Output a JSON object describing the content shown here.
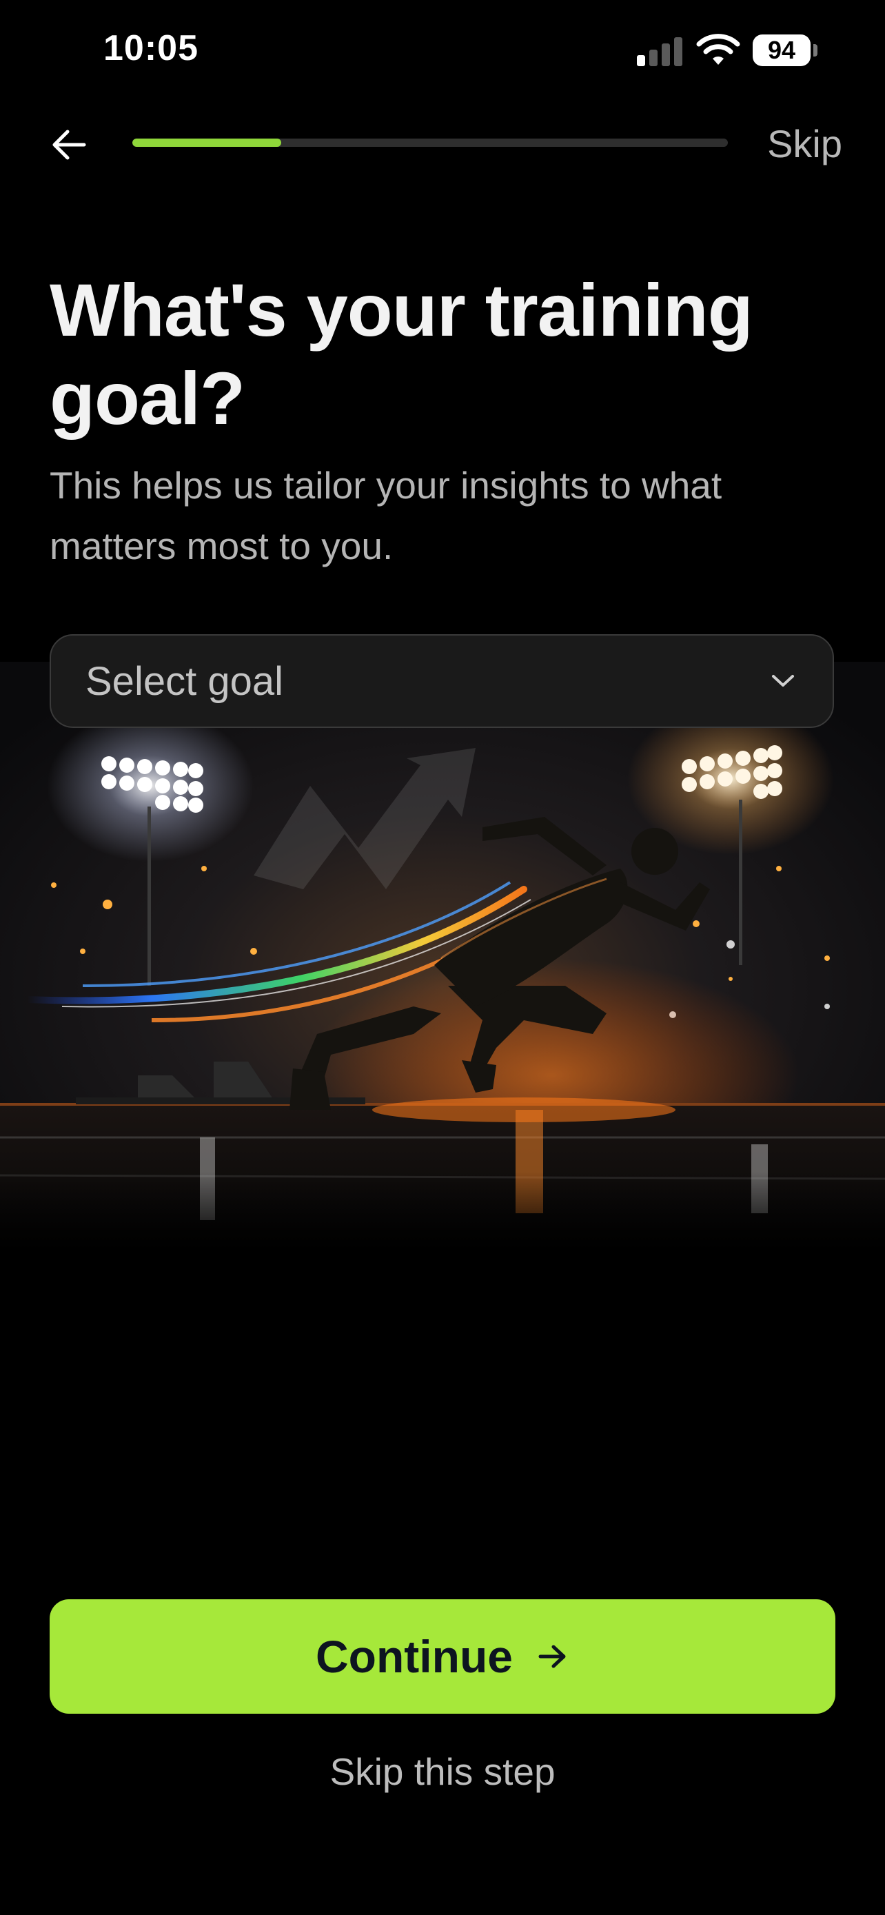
{
  "status_bar": {
    "time": "10:05",
    "battery_level": "94",
    "signal_bars_on": 1,
    "signal_bars_total": 4
  },
  "nav": {
    "back_icon": "arrow-left-icon",
    "skip_label": "Skip",
    "progress": 0.25,
    "progress_color": "#8fd63a"
  },
  "content": {
    "title": "What's your training goal?",
    "subtitle": "This helps us tailor your insights to what matters most to you."
  },
  "goal_select": {
    "placeholder": "Select goal",
    "icon": "chevron-down-icon"
  },
  "actions": {
    "continue_label": "Continue",
    "continue_icon": "arrow-right-icon",
    "continue_color": "#a6e83a",
    "skip_step_label": "Skip this step"
  }
}
